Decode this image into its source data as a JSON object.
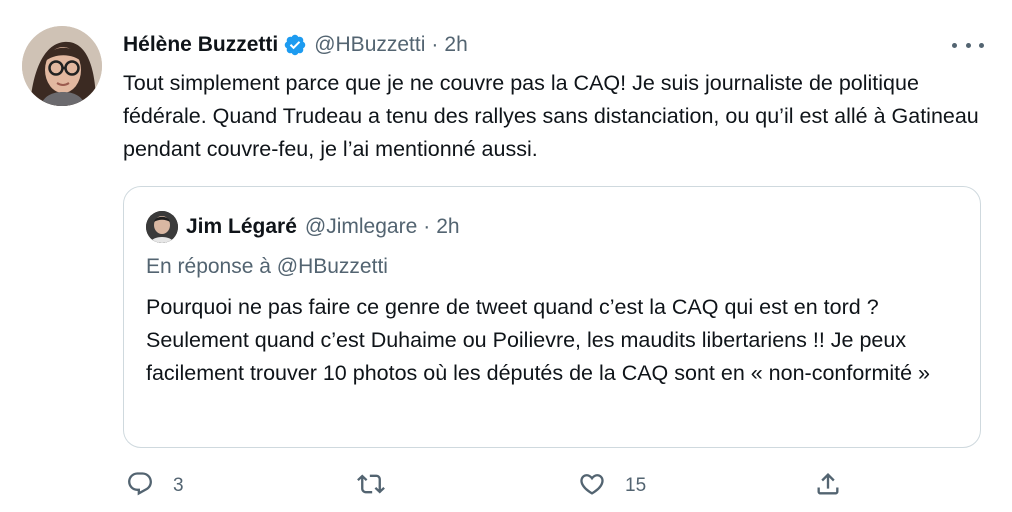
{
  "author": {
    "name": "Hélène Buzzetti",
    "handle": "@HBuzzetti",
    "separator": "·",
    "time": "2h"
  },
  "tweet_text": "Tout simplement parce que je ne couvre pas la CAQ! Je suis journaliste de politique fédérale. Quand Trudeau a tenu des rallyes sans distanciation, ou qu’il est allé à Gatineau pendant couvre-feu, je l’ai mentionné aussi.",
  "quoted": {
    "name": "Jim Légaré",
    "handle": "@Jimlegare",
    "separator": "·",
    "time": "2h",
    "reply_to": "En réponse à @HBuzzetti",
    "text": "Pourquoi ne pas faire ce genre de tweet quand c’est la CAQ qui est en tord ? Seulement quand c’est Duhaime ou Poilievre, les maudits libertariens !! Je peux facilement trouver 10 photos où les députés de la CAQ sont en « non-conformité »"
  },
  "actions": {
    "reply_count": "3",
    "retweet_count": "",
    "like_count": "15"
  },
  "icons": {
    "verified": "verified-badge-icon",
    "more": "more-icon",
    "reply": "reply-icon",
    "retweet": "retweet-icon",
    "like": "like-icon",
    "share": "share-icon"
  },
  "colors": {
    "verified": "#1d9bf0",
    "text": "#0f1419",
    "secondary": "#536471",
    "border": "#cfd9de"
  }
}
